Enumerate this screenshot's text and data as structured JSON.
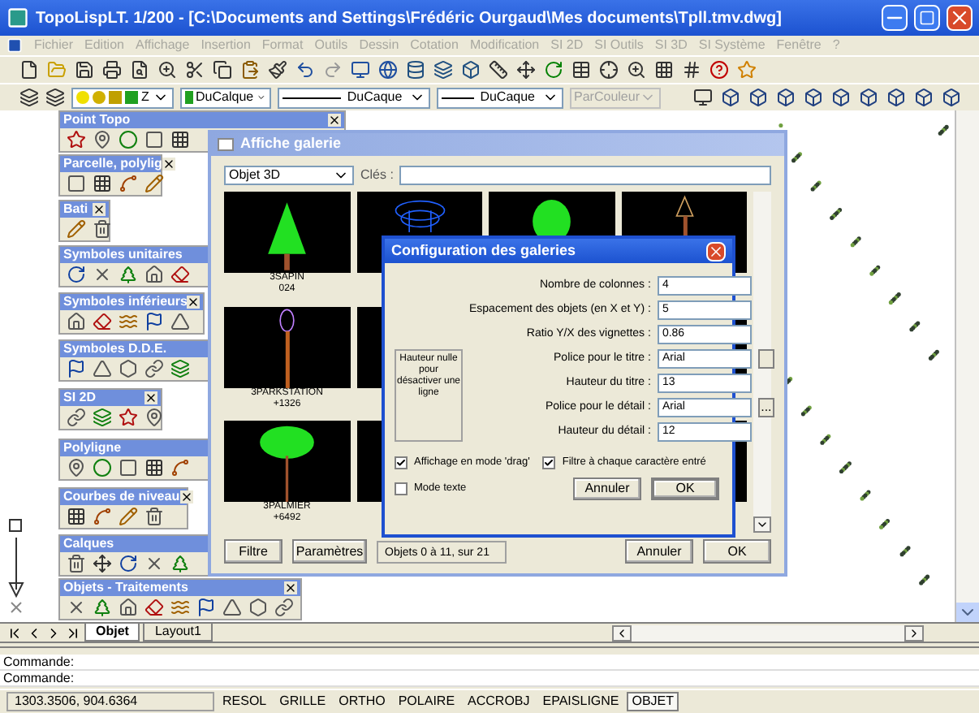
{
  "window": {
    "title": "TopoLispLT. 1/200 - [C:\\Documents and Settings\\Frédéric Ourgaud\\Mes documents\\Tpll.tmv.dwg]"
  },
  "menu": [
    "Fichier",
    "Edition",
    "Affichage",
    "Insertion",
    "Format",
    "Outils",
    "Dessin",
    "Cotation",
    "Modification",
    "SI 2D",
    "SI Outils",
    "SI 3D",
    "SI Système",
    "Fenêtre",
    "?"
  ],
  "properties_toolbar": {
    "layer": "Z",
    "color_property": "DuCalque",
    "linetype": "DuCaque",
    "lineweight": "DuCaque",
    "plot_style": {
      "value": "ParCouleur",
      "disabled": true
    }
  },
  "palettes": [
    {
      "title": "Point Topo",
      "closable": true
    },
    {
      "title": "Parcelle, polylig",
      "closable": true
    },
    {
      "title": "Bati",
      "closable": true
    },
    {
      "title": "Symboles unitaires",
      "closable": false
    },
    {
      "title": "Symboles inférieurs",
      "closable": true
    },
    {
      "title": "Symboles D.D.E.",
      "closable": false
    },
    {
      "title": "SI 2D",
      "closable": true
    },
    {
      "title": "Polyligne",
      "closable": false
    },
    {
      "title": "Courbes de niveau",
      "closable": true
    },
    {
      "title": "Calques",
      "closable": false
    },
    {
      "title": "Objets - Traitements",
      "closable": true
    }
  ],
  "gallery": {
    "title": "Affiche galerie",
    "category": "Objet 3D",
    "keys_label": "Clés :",
    "items": [
      {
        "kind": "cone-tree",
        "name": "3SAPIN",
        "detail": "024"
      },
      {
        "kind": "wire-fountain"
      },
      {
        "kind": "round-tree"
      },
      {
        "kind": "sign"
      },
      {
        "kind": "pole",
        "name": "3PARKSTATION",
        "detail": "+1326"
      },
      {
        "kind": "blank"
      },
      {
        "kind": "covered"
      },
      {
        "kind": "blank"
      },
      {
        "kind": "palm",
        "name": "3PALMIER",
        "detail": "+6492"
      },
      {
        "kind": "blank"
      },
      {
        "kind": "covered"
      },
      {
        "kind": "blank"
      }
    ],
    "filter_button": "Filtre",
    "settings_button": "Paramètres",
    "status": "Objets 0 à 11, sur 21",
    "cancel_button": "Annuler",
    "ok_button": "OK"
  },
  "config_dialog": {
    "title": "Configuration des galeries",
    "fields": [
      {
        "label": "Nombre de colonnes :",
        "value": "4",
        "kind": "plain"
      },
      {
        "label": "Espacement des objets (en X et Y) :",
        "value": "5",
        "kind": "plain"
      },
      {
        "label": "Ratio Y/X des vignettes :",
        "value": "0.86",
        "kind": "plain"
      },
      {
        "label": "Police pour le titre :",
        "value": "Arial",
        "kind": "picker"
      },
      {
        "label": "Hauteur du titre :",
        "value": "13",
        "kind": "plain"
      },
      {
        "label": "Police pour le détail :",
        "value": "Arial",
        "kind": "picker",
        "button_label": "..."
      },
      {
        "label": "Hauteur du détail :",
        "value": "12",
        "kind": "plain"
      }
    ],
    "hint": "Hauteur nulle pour désactiver une ligne",
    "checkboxes": [
      {
        "label": "Affichage en mode 'drag'",
        "checked": true
      },
      {
        "label": "Filtre à chaque caractère entré",
        "checked": true
      },
      {
        "label": "Mode texte",
        "checked": false
      }
    ],
    "cancel_button": "Annuler",
    "ok_button": "OK"
  },
  "layout_tabs": [
    {
      "label": "Objet",
      "selected": true
    },
    {
      "label": "Layout1",
      "selected": false
    }
  ],
  "command_lines": [
    "Commande:",
    "Commande:"
  ],
  "status_bar": {
    "coordinates": "1303.3506, 904.6364",
    "toggles": [
      {
        "label": "RESOL",
        "on": false
      },
      {
        "label": "GRILLE",
        "on": false
      },
      {
        "label": "ORTHO",
        "on": false
      },
      {
        "label": "POLAIRE",
        "on": false
      },
      {
        "label": "ACCROBJ",
        "on": false
      },
      {
        "label": "EPAISLIGNE",
        "on": false
      },
      {
        "label": "OBJET",
        "on": true
      }
    ]
  }
}
